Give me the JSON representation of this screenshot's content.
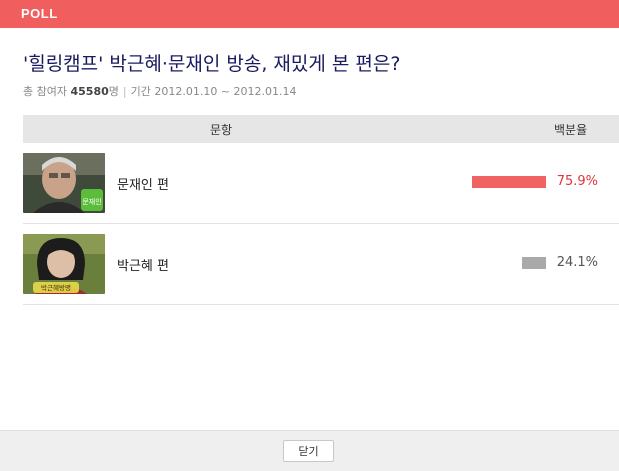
{
  "header": {
    "brand": "POLL",
    "accent_color": "#f15e5e"
  },
  "poll": {
    "title": "'힐링캠프' 박근혜·문재인 방송, 재밌게 본 편은?",
    "participants_label": "총 참여자",
    "participants_count": "45580",
    "participants_unit": "명",
    "period_label": "기간",
    "period_value": "2012.01.10 ~ 2012.01.14"
  },
  "table": {
    "headers": {
      "item": "문항",
      "percent": "백분율"
    },
    "options": [
      {
        "label": "문재인 편",
        "percent_text": "75.9%",
        "percent_value": 75.9,
        "bar_color": "#f06363",
        "text_color": "#e0363c",
        "thumbnail_icon": "person-photo-icon",
        "thumbnail_caption": "문재인"
      },
      {
        "label": "박근혜 편",
        "percent_text": "24.1%",
        "percent_value": 24.1,
        "bar_color": "#a9a9a9",
        "text_color": "#555555",
        "thumbnail_icon": "person-photo-icon",
        "thumbnail_caption": "박근혜방명"
      }
    ]
  },
  "footer": {
    "close_label": "닫기"
  }
}
